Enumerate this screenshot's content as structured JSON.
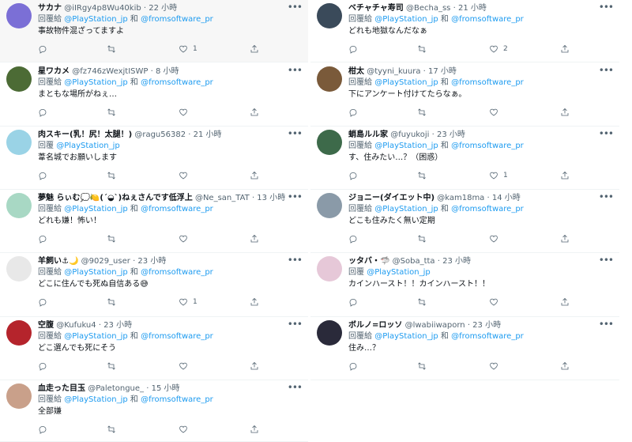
{
  "reply_prefix": "回覆給",
  "reply_prefix_single": "回覆",
  "conjunction": "和",
  "colors": {
    "mention": "#1d9bf0",
    "secondary": "#536471",
    "text": "#0f1419"
  },
  "left": [
    {
      "name": "サカナ",
      "handle": "@iIRgy4p8Wu40kib",
      "time": "· 22 小時",
      "mentions": [
        "@PlayStation_jp",
        "@fromsoftware_pr"
      ],
      "text": "事故物件混ざってますよ",
      "likes": "1",
      "avatar_color": "#7b6fd6"
    },
    {
      "name": "星ワカメ",
      "handle": "@fz746zWexjtISWP",
      "time": "· 8 小時",
      "mentions": [
        "@PlayStation_jp",
        "@fromsoftware_pr"
      ],
      "text": "まともな場所がねぇ…",
      "likes": "",
      "avatar_color": "#4c6b35"
    },
    {
      "name": "肉スキー(乳！尻！太腿！)",
      "handle": "@ragu56382",
      "time": "· 21 小時",
      "mentions": [
        "@PlayStation_jp"
      ],
      "single": true,
      "text": "葦名城でお願いします",
      "likes": "",
      "avatar_color": "#9ad3e6"
    },
    {
      "name": "夢魅 らぃむ💭🍋(´◒`)ねぇさんです低浮上",
      "handle": "@Ne_san_TAT",
      "time": "· 13 小時",
      "mentions": [
        "@PlayStation_jp",
        "@fromsoftware_pr"
      ],
      "text": "どれも嫌！怖い！",
      "likes": "",
      "avatar_color": "#a8d8c4"
    },
    {
      "name": "羊飼い⚓🌙",
      "handle": "@9029_user",
      "time": "· 23 小時",
      "mentions": [
        "@PlayStation_jp",
        "@fromsoftware_pr"
      ],
      "text": "どこに住んでも死ぬ自信ある😅",
      "likes": "1",
      "avatar_color": "#e8e8e8"
    },
    {
      "name": "空腹",
      "handle": "@Kufuku4",
      "time": "· 23 小時",
      "mentions": [
        "@PlayStation_jp",
        "@fromsoftware_pr"
      ],
      "text": "どこ選んでも死にそう",
      "likes": "",
      "avatar_color": "#b5242c"
    },
    {
      "name": "血走った目玉",
      "handle": "@Paletongue_",
      "time": "· 15 小時",
      "mentions": [
        "@PlayStation_jp",
        "@fromsoftware_pr"
      ],
      "text": "全部嫌",
      "likes": "",
      "avatar_color": "#c9a08a"
    }
  ],
  "right": [
    {
      "name": "ベチャチャ寿司",
      "handle": "@Becha_ss",
      "time": "· 21 小時",
      "mentions": [
        "@PlayStation_jp",
        "@fromsoftware_pr"
      ],
      "text": "どれも地獄なんだなぁ",
      "likes": "2",
      "avatar_color": "#3a4a5a"
    },
    {
      "name": "柑太",
      "handle": "@tyyni_kuura",
      "time": "· 17 小時",
      "mentions": [
        "@PlayStation_jp",
        "@fromsoftware_pr"
      ],
      "text": "下にアンケート付けてたらなぁ。",
      "likes": "",
      "avatar_color": "#7a5a3a"
    },
    {
      "name": "蛸島ルル家",
      "handle": "@fuyukoji",
      "time": "· 23 小時",
      "mentions": [
        "@PlayStation_jp",
        "@fromsoftware_pr"
      ],
      "text": "す、住みたい…？（困惑）",
      "likes": "1",
      "avatar_color": "#3d6a4a"
    },
    {
      "name": "ジョニー(ダイエット中)",
      "handle": "@kam18ma",
      "time": "· 14 小時",
      "mentions": [
        "@PlayStation_jp",
        "@fromsoftware_pr"
      ],
      "text": "どこも住みたく無い定期",
      "likes": "",
      "avatar_color": "#8a9aa8"
    },
    {
      "name": "ッタバ・🦈",
      "handle": "@Soba_tta",
      "time": "· 23 小時",
      "mentions": [
        "@PlayStation_jp"
      ],
      "single": true,
      "text": "カインハースト！！カインハースト！！",
      "likes": "",
      "avatar_color": "#e6c8d8"
    },
    {
      "name": "ボルノ=ロッソ",
      "handle": "@lwabiiwaporn",
      "time": "· 23 小時",
      "mentions": [
        "@PlayStation_jp",
        "@fromsoftware_pr"
      ],
      "text": "住み…？",
      "likes": "",
      "avatar_color": "#2a2a3a"
    }
  ]
}
